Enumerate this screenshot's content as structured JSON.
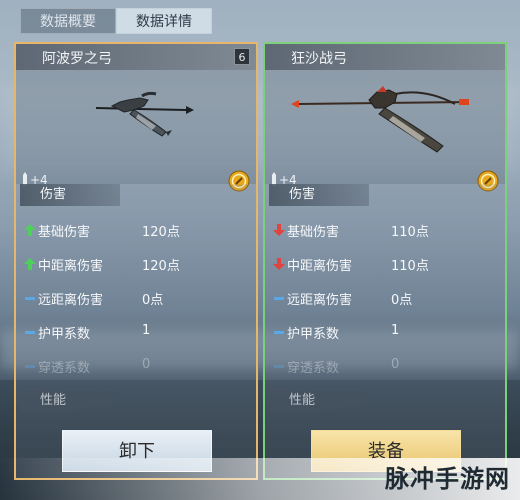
{
  "tabs": [
    {
      "label": "数据概要",
      "active": false
    },
    {
      "label": "数据详情",
      "active": true
    }
  ],
  "cards": [
    {
      "name": "阿波罗之弓",
      "count_badge": "6",
      "level": "+4",
      "frame_color": "#e6b66a",
      "section_damage": "伤害",
      "stats": [
        {
          "label": "基础伤害",
          "value": "120点",
          "indicator": "up"
        },
        {
          "label": "中距离伤害",
          "value": "120点",
          "indicator": "up"
        },
        {
          "label": "远距离伤害",
          "value": "0点",
          "indicator": "equal"
        },
        {
          "label": "护甲系数",
          "value": "1",
          "indicator": "equal"
        },
        {
          "label": "穿透系数",
          "value": "0",
          "indicator": "equal"
        }
      ],
      "section_performance": "性能",
      "action_label": "卸下"
    },
    {
      "name": "狂沙战弓",
      "level": "+4",
      "frame_color": "#7cd07c",
      "section_damage": "伤害",
      "stats": [
        {
          "label": "基础伤害",
          "value": "110点",
          "indicator": "down"
        },
        {
          "label": "中距离伤害",
          "value": "110点",
          "indicator": "down"
        },
        {
          "label": "远距离伤害",
          "value": "0点",
          "indicator": "equal"
        },
        {
          "label": "护甲系数",
          "value": "1",
          "indicator": "equal"
        },
        {
          "label": "穿透系数",
          "value": "0",
          "indicator": "equal"
        }
      ],
      "section_performance": "性能",
      "action_label": "装备"
    }
  ],
  "watermark": "脉冲手游网",
  "colors": {
    "up": "#4fd05a",
    "down": "#e0443c",
    "equal": "#5aa8e6"
  }
}
